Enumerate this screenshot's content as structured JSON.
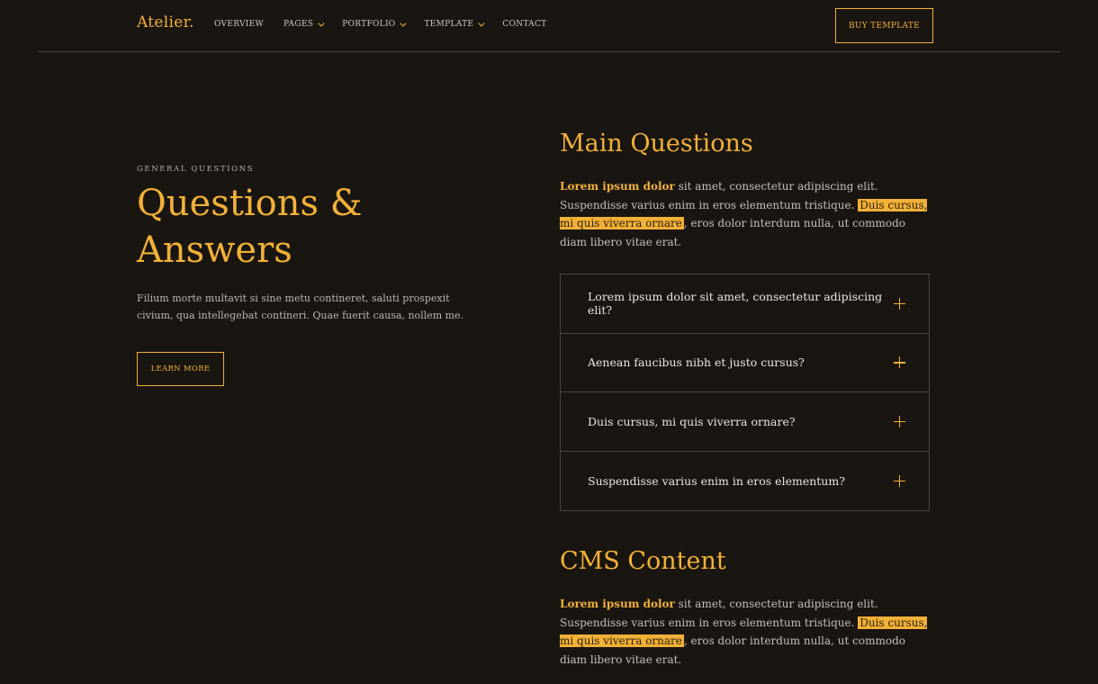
{
  "nav": {
    "brand": "Atelier.",
    "items": [
      {
        "label": "OVERVIEW",
        "dropdown": false
      },
      {
        "label": "PAGES",
        "dropdown": true
      },
      {
        "label": "PORTFOLIO",
        "dropdown": true
      },
      {
        "label": "TEMPLATE",
        "dropdown": true
      },
      {
        "label": "CONTACT",
        "dropdown": false
      }
    ],
    "buy_label": "BUY TEMPLATE"
  },
  "hero": {
    "eyebrow": "GENERAL QUESTIONS",
    "title": "Questions & Answers",
    "text": "Filium morte multavit si sine metu contineret, saluti prospexit civium, qua intellegebat contineri. Quae fuerit causa, nollem me.",
    "button": "LEARN MORE"
  },
  "main_questions": {
    "title": "Main Questions",
    "para": {
      "bold": "Lorem ipsum dolor",
      "text1": " sit amet, consectetur adipiscing elit. Suspendisse varius enim in eros elementum tristique. ",
      "highlight": "Duis cursus, mi quis viverra ornare",
      "text2": ", eros dolor interdum nulla, ut commodo diam libero vitae erat."
    }
  },
  "faq": [
    {
      "question": "Lorem ipsum dolor sit amet, consectetur adipiscing elit?"
    },
    {
      "question": "Aenean faucibus nibh et justo cursus?"
    },
    {
      "question": "Duis cursus, mi quis viverra ornare?"
    },
    {
      "question": "Suspendisse varius enim in eros elementum?"
    }
  ],
  "cms": {
    "title": "CMS Content",
    "para": {
      "bold": "Lorem ipsum dolor",
      "text1": " sit amet, consectetur adipiscing elit. Suspendisse varius enim in eros elementum tristique. ",
      "highlight": "Duis cursus, mi quis viverra ornare",
      "text2": ", eros dolor interdum nulla, ut commodo diam libero vitae erat."
    }
  },
  "colors": {
    "background": "#191511",
    "accent": "#f2b137",
    "divider": "#4a443c"
  },
  "icons": [
    "chevron-down-icon",
    "plus-icon"
  ]
}
